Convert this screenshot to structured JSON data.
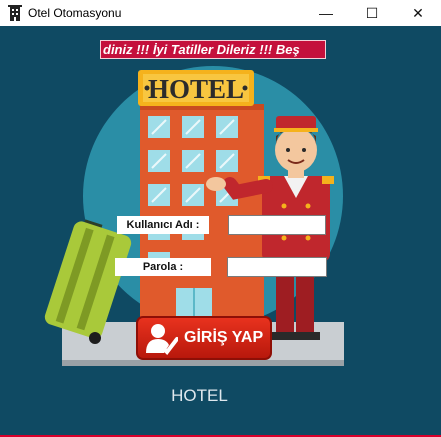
{
  "window": {
    "title": "Otel Otomasyonu",
    "minimize_glyph": "—",
    "maximize_glyph": "☐",
    "close_glyph": "✕"
  },
  "marquee": {
    "text": "diniz !!!  İyi Tatiller Dileriz !!!  Beş"
  },
  "hotel_sign": {
    "text": "HOTEL"
  },
  "login": {
    "username_label": "Kullanıcı Adı :",
    "username_value": "",
    "password_label": "Parola :",
    "password_value": "",
    "button_label": "GİRİŞ YAP"
  },
  "footer": {
    "text": "HOTEL"
  },
  "colors": {
    "background": "#0f4a63",
    "marquee_bg": "#c4103c",
    "button_red": "#d4261a",
    "building_orange": "#e05a2c",
    "bellboy_red": "#c0272d"
  },
  "icons": [
    "hotel-app-icon",
    "user-check-icon",
    "luggage-icon",
    "bellboy-illustration"
  ]
}
